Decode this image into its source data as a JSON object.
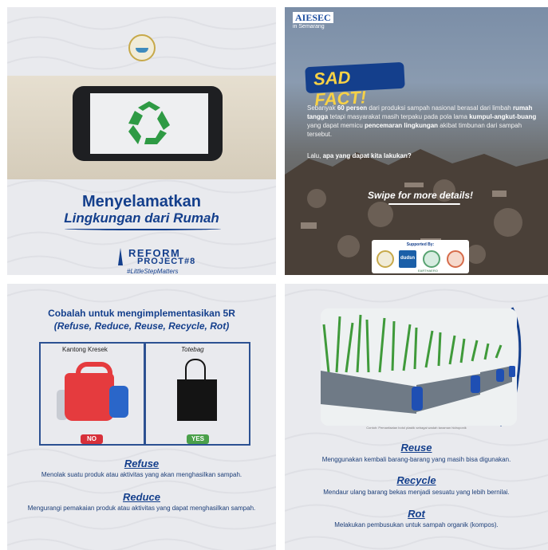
{
  "panel1": {
    "title_line1": "Menyelamatkan",
    "title_line2": "Lingkungan dari Rumah",
    "reform": "REFORM",
    "project": "PROJECT#8",
    "hashtag": "#LittleStepMatters",
    "icon": "recycle-icon"
  },
  "panel2": {
    "org": "AIESEC",
    "org_sub": "in Semarang",
    "badge": "SAD FACT!",
    "fact_1": "Sebanyak ",
    "fact_2": "60 persen",
    "fact_3": " dari produksi sampah nasional berasal dari limbah ",
    "fact_4": "rumah tangga",
    "fact_5": " tetapi masyarakat masih terpaku pada pola lama ",
    "fact_6": "kumpul-angkut-buang",
    "fact_7": " yang dapat memicu ",
    "fact_8": "pencemaran lingkungan",
    "fact_9": " akibat timbunan dari sampah tersebut.",
    "question_1": "Lalu, ",
    "question_2": "apa yang dapat kita lakukan?",
    "swipe": "Swipe for more details!",
    "supported_by": "Supported By:",
    "sponsor_2": "dudsn",
    "sponsor_3": "EARTHAERO"
  },
  "panel3": {
    "title_line1": "Cobalah untuk mengimplementasikan 5R",
    "title_line2": "(Refuse, Reduce, Reuse, Recycle, Rot)",
    "col_left": "Kantong Kresek",
    "col_right": "Totebag",
    "badge_no": "NO",
    "badge_yes": "YES",
    "refuse_title": "Refuse",
    "refuse_desc": "Menolak suatu produk atau aktivitas yang akan menghasilkan sampah.",
    "reduce_title": "Reduce",
    "reduce_desc": "Mengurangi pemakaian produk atau aktivitas yang dapat menghasilkan sampah."
  },
  "panel4": {
    "caption": "Contoh: Pemanfaatan botol plastik sebagai wadah tanaman hidroponik",
    "reuse_title": "Reuse",
    "reuse_desc": "Menggunakan kembali barang-barang yang masih bisa digunakan.",
    "recycle_title": "Recycle",
    "recycle_desc": "Mendaur ulang barang bekas menjadi sesuatu yang lebih bernilai.",
    "rot_title": "Rot",
    "rot_desc": "Melakukan pembusukan untuk sampah organik (kompos)."
  },
  "colors": {
    "navy": "#143f8c",
    "yellow": "#f7d146",
    "red": "#d7303a",
    "green": "#4aa04a"
  }
}
